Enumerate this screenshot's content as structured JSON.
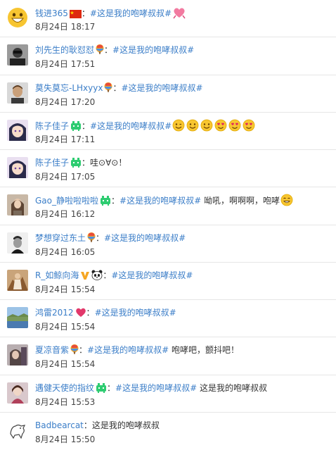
{
  "items": [
    {
      "username": "钱进365",
      "separator": "：",
      "tag": "#这是我的咆哮叔叔#",
      "text": "",
      "time": "8月24日 18:17"
    },
    {
      "username": "刘先生的耿怼怼",
      "separator": "：",
      "tag": "#这是我的咆哮叔叔#",
      "text": "",
      "time": "8月24日 17:51"
    },
    {
      "username": "莫失莫忘-LHxyyx",
      "separator": "：",
      "tag": "#这是我的咆哮叔叔#",
      "text": "",
      "time": "8月24日 17:20"
    },
    {
      "username": "陈子佳子",
      "separator": "：",
      "tag": "#这是我的咆哮叔叔#",
      "text": "",
      "time": "8月24日 17:11"
    },
    {
      "username": "陈子佳子",
      "separator": "：",
      "tag": "",
      "text": "哇⊙∀⊙！",
      "time": "8月24日 17:05"
    },
    {
      "username": "Gao_静啦啦啦啦",
      "separator": "：",
      "tag": "#这是我的咆哮叔叔#",
      "text": " 呦吼，啊啊啊，咆哮",
      "time": "8月24日 16:12"
    },
    {
      "username": "梦想穿过东土",
      "separator": "：",
      "tag": "#这是我的咆哮叔叔#",
      "text": "",
      "time": "8月24日 16:05"
    },
    {
      "username": "R_如鲸向海",
      "separator": "：",
      "tag": "#这是我的咆哮叔叔#",
      "text": "",
      "time": "8月24日 15:54"
    },
    {
      "username": "鸿雷2012",
      "separator": "：",
      "tag": "#这是我的咆哮叔叔#",
      "text": "",
      "time": "8月24日 15:54"
    },
    {
      "username": "夏凉音紫",
      "separator": "：",
      "tag": "#这是我的咆哮叔叔#",
      "text": " 咆哮吧，颤抖吧！",
      "time": "8月24日 15:54"
    },
    {
      "username": "遇健天使的指纹",
      "separator": "：",
      "tag": "#这是我的咆哮叔叔#",
      "text": " 这是我的咆哮叔叔",
      "time": "8月24日 15:53"
    },
    {
      "username": "Badbearcat",
      "separator": "：",
      "tag": "",
      "text": "这是我的咆哮叔叔",
      "time": "8月24日 15:50"
    }
  ],
  "colors": {
    "link": "#3b7ec8",
    "text": "#333333",
    "divider": "#e6e6e6"
  }
}
